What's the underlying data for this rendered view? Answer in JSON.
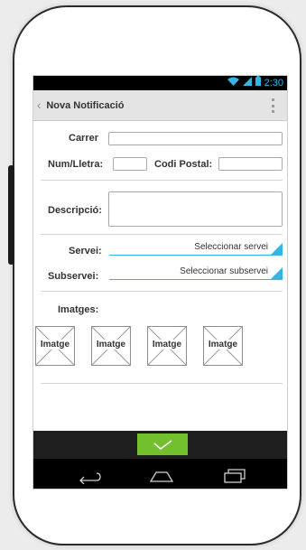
{
  "status_bar": {
    "time": "2:30",
    "icons": [
      "wifi-icon",
      "signal-icon",
      "battery-icon"
    ]
  },
  "action_bar": {
    "title": "Nova Notificació",
    "back_icon": "chevron-left-icon",
    "overflow_icon": "overflow-menu-icon"
  },
  "form": {
    "carrer_label": "Carrer",
    "carrer_value": "",
    "num_label": "Num/Lletra:",
    "num_value": "",
    "codi_label": "Codi Postal:",
    "codi_value": "",
    "descripcio_label": "Descripció:",
    "descripcio_value": "",
    "servei_label": "Servei:",
    "servei_selected": "Seleccionar servei",
    "subservei_label": "Subservei:",
    "subservei_selected": "Seleccionar subservei",
    "imatges_label": "Imatges:",
    "images": [
      "Imatge",
      "Imatge",
      "Imatge",
      "Imatge"
    ]
  },
  "bottom_bar": {
    "confirm_icon": "checkmark-icon"
  },
  "nav_bar": {
    "icons": [
      "back-icon",
      "home-icon",
      "recent-apps-icon"
    ]
  },
  "colors": {
    "accent": "#33b5e5",
    "confirm": "#73c02f",
    "bar": "#1f1f1f"
  }
}
